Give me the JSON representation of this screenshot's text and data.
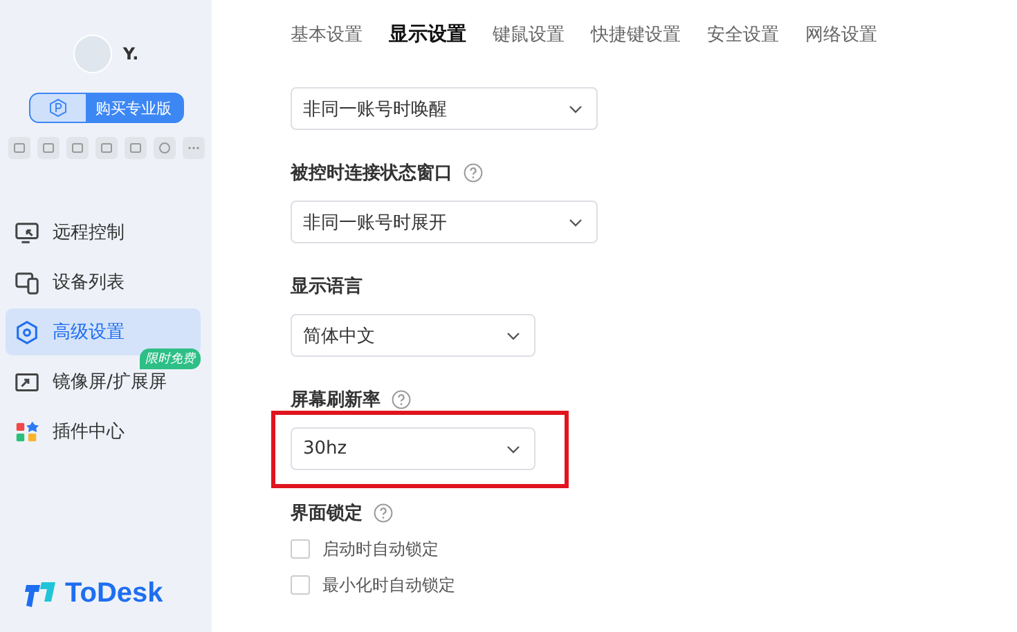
{
  "user": {
    "name": "Y."
  },
  "upgrade_button": {
    "label": "购买专业版"
  },
  "nav": [
    {
      "label": "远程控制",
      "selected": false
    },
    {
      "label": "设备列表",
      "selected": false
    },
    {
      "label": "高级设置",
      "selected": true
    },
    {
      "label": "镜像屏/扩展屏",
      "selected": false,
      "badge": "限时免费"
    },
    {
      "label": "插件中心",
      "selected": false
    }
  ],
  "logo": {
    "text": "ToDesk"
  },
  "tabs": [
    {
      "label": "基本设置",
      "selected": false
    },
    {
      "label": "显示设置",
      "selected": true
    },
    {
      "label": "键鼠设置",
      "selected": false
    },
    {
      "label": "快捷键设置",
      "selected": false
    },
    {
      "label": "安全设置",
      "selected": false
    },
    {
      "label": "网络设置",
      "selected": false
    }
  ],
  "sections": [
    {
      "kind": "select",
      "value": "非同一账号时唤醒",
      "wide": true
    },
    {
      "kind": "select",
      "label": "被控时连接状态窗口",
      "help": true,
      "value": "非同一账号时展开",
      "wide": true
    },
    {
      "kind": "select",
      "label": "显示语言",
      "help": false,
      "value": "简体中文",
      "wide": false
    },
    {
      "kind": "select",
      "label": "屏幕刷新率",
      "help": true,
      "value": "30hz",
      "wide": false,
      "highlighted": true
    },
    {
      "kind": "checkboxes",
      "label": "界面锁定",
      "help": true,
      "options": [
        {
          "label": "启动时自动锁定",
          "checked": false
        },
        {
          "label": "最小化时自动锁定",
          "checked": false
        }
      ]
    }
  ]
}
